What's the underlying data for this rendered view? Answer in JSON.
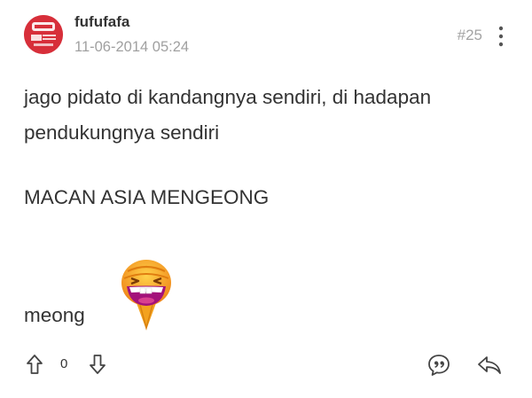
{
  "post": {
    "username": "fufufafa",
    "timestamp": "11-06-2014 05:24",
    "post_number": "#25",
    "body_lines": [
      "jago pidato di kandangnya sendiri, di hadapan",
      "pendukungnya sendiri",
      "MACAN ASIA MENGEONG",
      "meong"
    ],
    "emoticon": "laughing-face-emoticon",
    "vote_count": "0"
  },
  "icons": {
    "avatar": "avatar-logo",
    "more": "vertical-dots-icon",
    "upvote": "arrow-up-icon",
    "downvote": "arrow-down-icon",
    "quote": "quote-bubble-icon",
    "reply": "reply-arrow-icon"
  },
  "colors": {
    "text": "#333333",
    "muted": "#a0a0a0",
    "avatar_red": "#d72f3a",
    "emoticon_orange": "#f5a623"
  }
}
